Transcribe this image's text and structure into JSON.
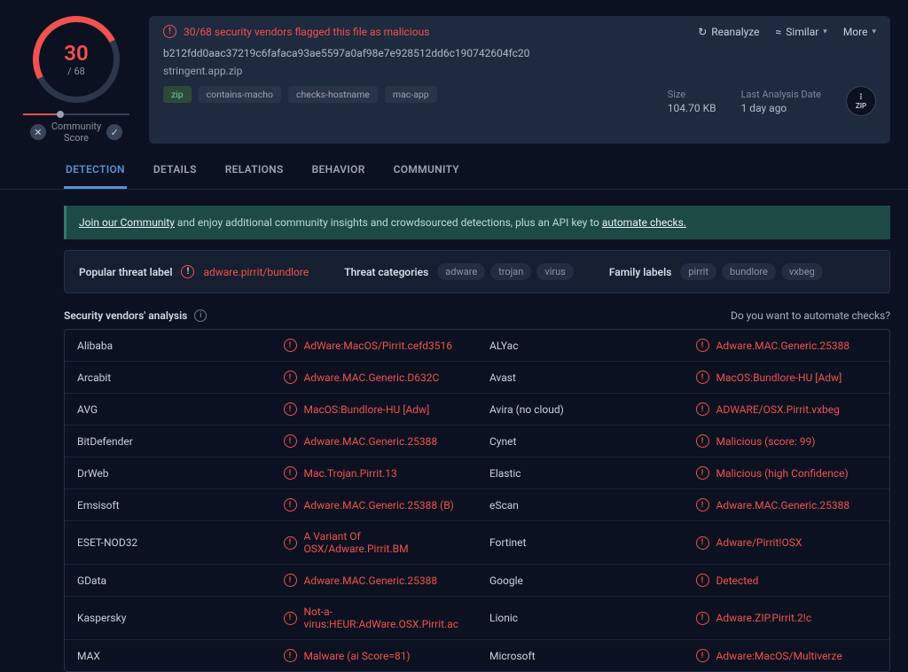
{
  "score": {
    "flagged": "30",
    "total": "/ 68",
    "community_label": "Community\nScore"
  },
  "summary": {
    "flag_line": "30/68 security vendors flagged this file as malicious",
    "reanalyze": "Reanalyze",
    "similar": "Similar",
    "more": "More",
    "hash": "b212fdd0aac37219c6fafaca93ae5597a0af98e7e928512dd6c190742604fc20",
    "filename": "stringent.app.zip",
    "tags": [
      "zip",
      "contains-macho",
      "checks-hostname",
      "mac-app"
    ],
    "size_label": "Size",
    "size_value": "104.70 KB",
    "date_label": "Last Analysis Date",
    "date_value": "1 day ago",
    "zip_label": "ZIP"
  },
  "tabs": [
    "DETECTION",
    "DETAILS",
    "RELATIONS",
    "BEHAVIOR",
    "COMMUNITY"
  ],
  "banner": {
    "link1": "Join our Community",
    "mid": " and enjoy additional community insights and crowdsourced detections, plus an API key to ",
    "link2": "automate checks."
  },
  "categories": {
    "popular_label": "Popular threat label",
    "popular_value": "adware.pirrit/bundlore",
    "threat_label": "Threat categories",
    "threat_tags": [
      "adware",
      "trojan",
      "virus"
    ],
    "family_label": "Family labels",
    "family_tags": [
      "pirrit",
      "bundlore",
      "vxbeg"
    ]
  },
  "analysis_header": {
    "title": "Security vendors' analysis",
    "automate": "Do you want to automate checks?"
  },
  "vendors": [
    {
      "a": "Alibaba",
      "ar": "AdWare:MacOS/Pirrit.cefd3516",
      "b": "ALYac",
      "br": "Adware.MAC.Generic.25388"
    },
    {
      "a": "Arcabit",
      "ar": "Adware.MAC.Generic.D632C",
      "b": "Avast",
      "br": "MacOS:Bundlore-HU [Adw]"
    },
    {
      "a": "AVG",
      "ar": "MacOS:Bundlore-HU [Adw]",
      "b": "Avira (no cloud)",
      "br": "ADWARE/OSX.Pirrit.vxbeg"
    },
    {
      "a": "BitDefender",
      "ar": "Adware.MAC.Generic.25388",
      "b": "Cynet",
      "br": "Malicious (score: 99)"
    },
    {
      "a": "DrWeb",
      "ar": "Mac.Trojan.Pirrit.13",
      "b": "Elastic",
      "br": "Malicious (high Confidence)"
    },
    {
      "a": "Emsisoft",
      "ar": "Adware.MAC.Generic.25388 (B)",
      "b": "eScan",
      "br": "Adware.MAC.Generic.25388"
    },
    {
      "a": "ESET-NOD32",
      "ar": "A Variant Of OSX/Adware.Pirrit.BM",
      "b": "Fortinet",
      "br": "Adware/Pirrit!OSX"
    },
    {
      "a": "GData",
      "ar": "Adware.MAC.Generic.25388",
      "b": "Google",
      "br": "Detected"
    },
    {
      "a": "Kaspersky",
      "ar": "Not-a-virus:HEUR:AdWare.OSX.Pirrit.ac",
      "b": "Lionic",
      "br": "Adware.ZIP.Pirrit.2!c"
    },
    {
      "a": "MAX",
      "ar": "Malware (ai Score=81)",
      "b": "Microsoft",
      "br": "Adware:MacOS/Multiverze"
    }
  ]
}
